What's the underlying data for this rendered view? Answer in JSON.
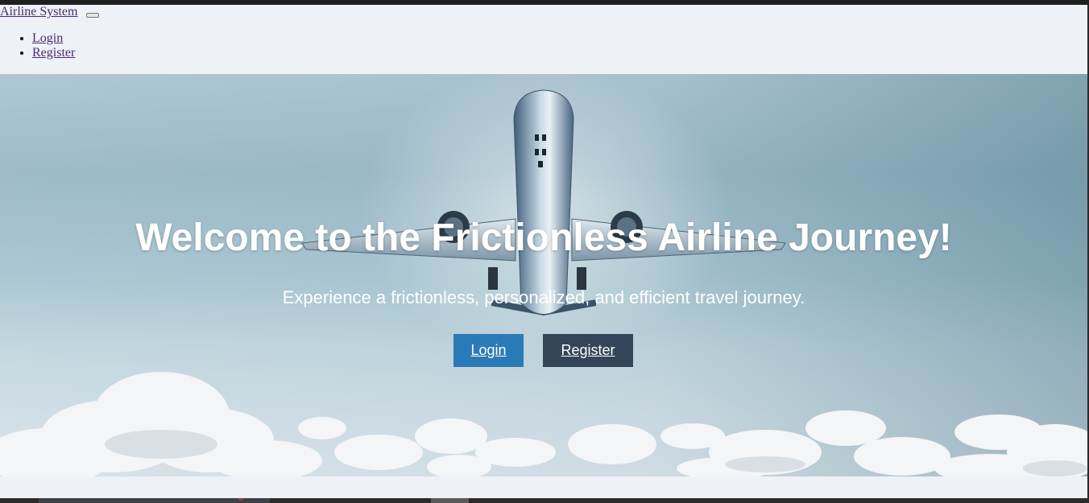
{
  "navbar": {
    "brand": "Airline System",
    "menu": [
      "Login",
      "Register"
    ]
  },
  "hero": {
    "title": "Welcome to the Frictionless Airline Journey!",
    "subtitle": "Experience a frictionless, personalized, and efficient travel journey.",
    "login_label": "Login",
    "register_label": "Register"
  },
  "colors": {
    "login_button": "#2b7ab8",
    "register_button": "#344559",
    "link": "#4a2c73",
    "page_background": "#eef1f6"
  },
  "icons": {
    "navbar_toggler": "hamburger-toggler-icon",
    "hero_image": "airplane-in-clouds-image"
  }
}
